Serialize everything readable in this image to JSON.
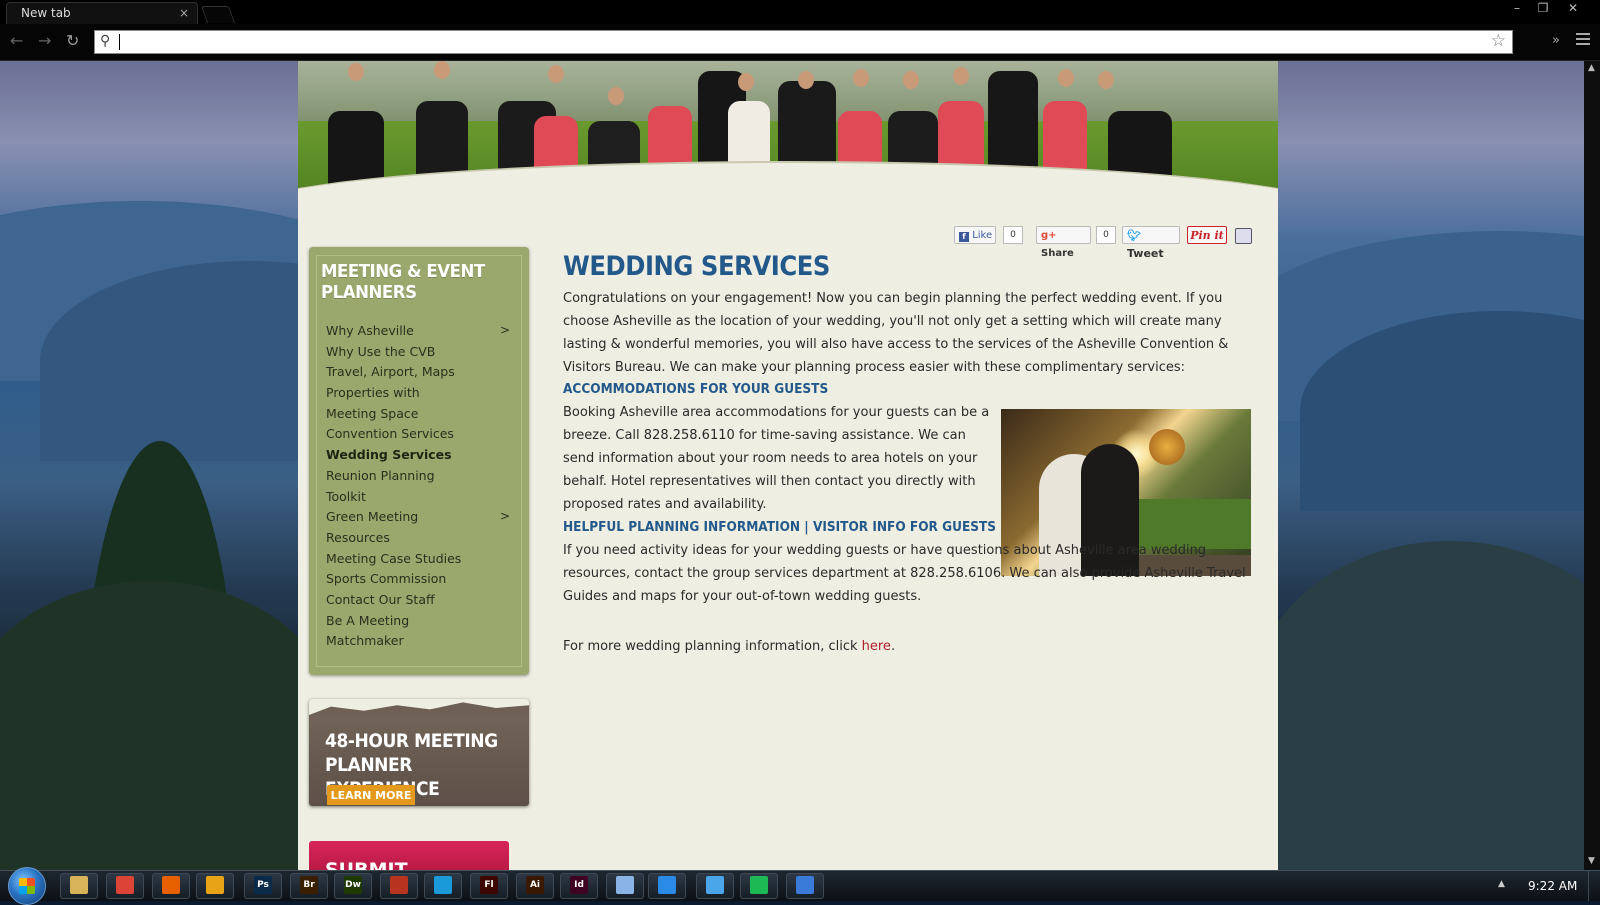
{
  "browser": {
    "tab_title": "New tab",
    "tab_close": "×",
    "omnibox_value": "",
    "back_icon": "arrow-left-icon",
    "forward_icon": "arrow-right-icon",
    "reload_icon": "reload-icon",
    "star_icon": "star-icon",
    "menu_icon": "hamburger-menu-icon"
  },
  "banner": {
    "image": "wedding party jumping on lawn"
  },
  "share": {
    "like_label": "Like",
    "like_count": "0",
    "gplus_label": "Share",
    "gplus_count": "0",
    "tweet_label": "Tweet",
    "pin_label": "Pin it",
    "print_icon": "printer-icon",
    "colors": {
      "facebook": "#3b5998",
      "twitter": "#1da1f2",
      "pinterest": "#cb2027",
      "gplus": "#dd4b39"
    }
  },
  "sidebar": {
    "title": "MEETING & EVENT PLANNERS",
    "items": [
      {
        "label": "Why Asheville",
        "arrow": ">"
      },
      {
        "label": "Why Use the CVB",
        "arrow": ""
      },
      {
        "label": "Travel, Airport, Maps",
        "arrow": ""
      },
      {
        "label": "Properties with",
        "arrow": ""
      },
      {
        "label": "Meeting Space",
        "arrow": ""
      },
      {
        "label": "Convention Services",
        "arrow": ""
      },
      {
        "label": "Wedding Services",
        "arrow": "",
        "active": true
      },
      {
        "label": "Reunion Planning",
        "arrow": ""
      },
      {
        "label": "Toolkit",
        "arrow": ""
      },
      {
        "label": "Green Meeting",
        "arrow": ">"
      },
      {
        "label": "Resources",
        "arrow": ""
      },
      {
        "label": "Meeting Case Studies",
        "arrow": ""
      },
      {
        "label": "Sports Commission",
        "arrow": ""
      },
      {
        "label": "Contact Our Staff",
        "arrow": ""
      },
      {
        "label": "Be A Meeting",
        "arrow": ""
      },
      {
        "label": "Matchmaker",
        "arrow": ""
      }
    ],
    "background_color": "#9aa86e"
  },
  "promo": {
    "title_line1": "48-HOUR MEETING",
    "title_line2": "PLANNER EXPERIENCE",
    "button_label": "LEARN MORE"
  },
  "submit_banner": {
    "label": "SUBMIT"
  },
  "content": {
    "heading": "WEDDING SERVICES",
    "intro": "Congratulations on your engagement! Now you can begin planning the perfect wedding event. If you choose Asheville as the location of your wedding, you'll not only get a setting which will create many lasting & wonderful memories, you will also have access to the services of the Asheville Convention & Visitors Bureau. We can make your planning process easier with these complimentary services:",
    "section1_heading": "ACCOMMODATIONS FOR YOUR GUESTS",
    "section1_body": "Booking Asheville area accommodations for your guests can be a breeze. Call 828.258.6110 for time-saving assistance. We can send information about your room needs to area hotels on your behalf. Hotel representatives will then contact you directly with proposed rates and availability.",
    "section2_heading": "HELPFUL PLANNING INFORMATION | VISITOR INFO FOR GUESTS",
    "section2_body": "If you need activity ideas for your wedding guests or have questions about Asheville area wedding resources, contact the group services department at 828.258.6106. We can also provide Asheville Travel Guides and maps for your out-of-town wedding guests.",
    "more_prefix": "For more wedding planning information, click ",
    "more_link": "here",
    "more_suffix": ".",
    "heading_color": "#23588b",
    "link_color": "#b01e2c"
  },
  "taskbar": {
    "apps": [
      {
        "name": "file-explorer-icon",
        "label": "",
        "color": "#d9b35a"
      },
      {
        "name": "chrome-icon",
        "label": "",
        "color": "#db4437"
      },
      {
        "name": "firefox-icon",
        "label": "",
        "color": "#e66000"
      },
      {
        "name": "outlook-icon",
        "label": "",
        "color": "#e8a317"
      },
      {
        "name": "photoshop-icon",
        "label": "Ps",
        "color": "#0a2a4a"
      },
      {
        "name": "bridge-icon",
        "label": "Br",
        "color": "#3a1e00"
      },
      {
        "name": "dreamweaver-icon",
        "label": "Dw",
        "color": "#1f3a00"
      },
      {
        "name": "filezilla-icon",
        "label": "",
        "color": "#b8341f"
      },
      {
        "name": "chat-icon",
        "label": "",
        "color": "#1a9ad8"
      },
      {
        "name": "flash-icon",
        "label": "Fl",
        "color": "#3d0600"
      },
      {
        "name": "illustrator-icon",
        "label": "Ai",
        "color": "#3a1800"
      },
      {
        "name": "indesign-icon",
        "label": "Id",
        "color": "#3e0320"
      },
      {
        "name": "notepad-icon",
        "label": "",
        "color": "#8ab4e6"
      },
      {
        "name": "messenger-icon",
        "label": "",
        "color": "#2a8ae6"
      },
      {
        "name": "itunes-icon",
        "label": "",
        "color": "#4aa6e8"
      },
      {
        "name": "spotify-icon",
        "label": "",
        "color": "#1db954"
      },
      {
        "name": "window-icon",
        "label": "",
        "color": "#3a7ad8"
      }
    ],
    "clock": "9:22 AM",
    "tray_icon": "show-hidden-icons"
  }
}
